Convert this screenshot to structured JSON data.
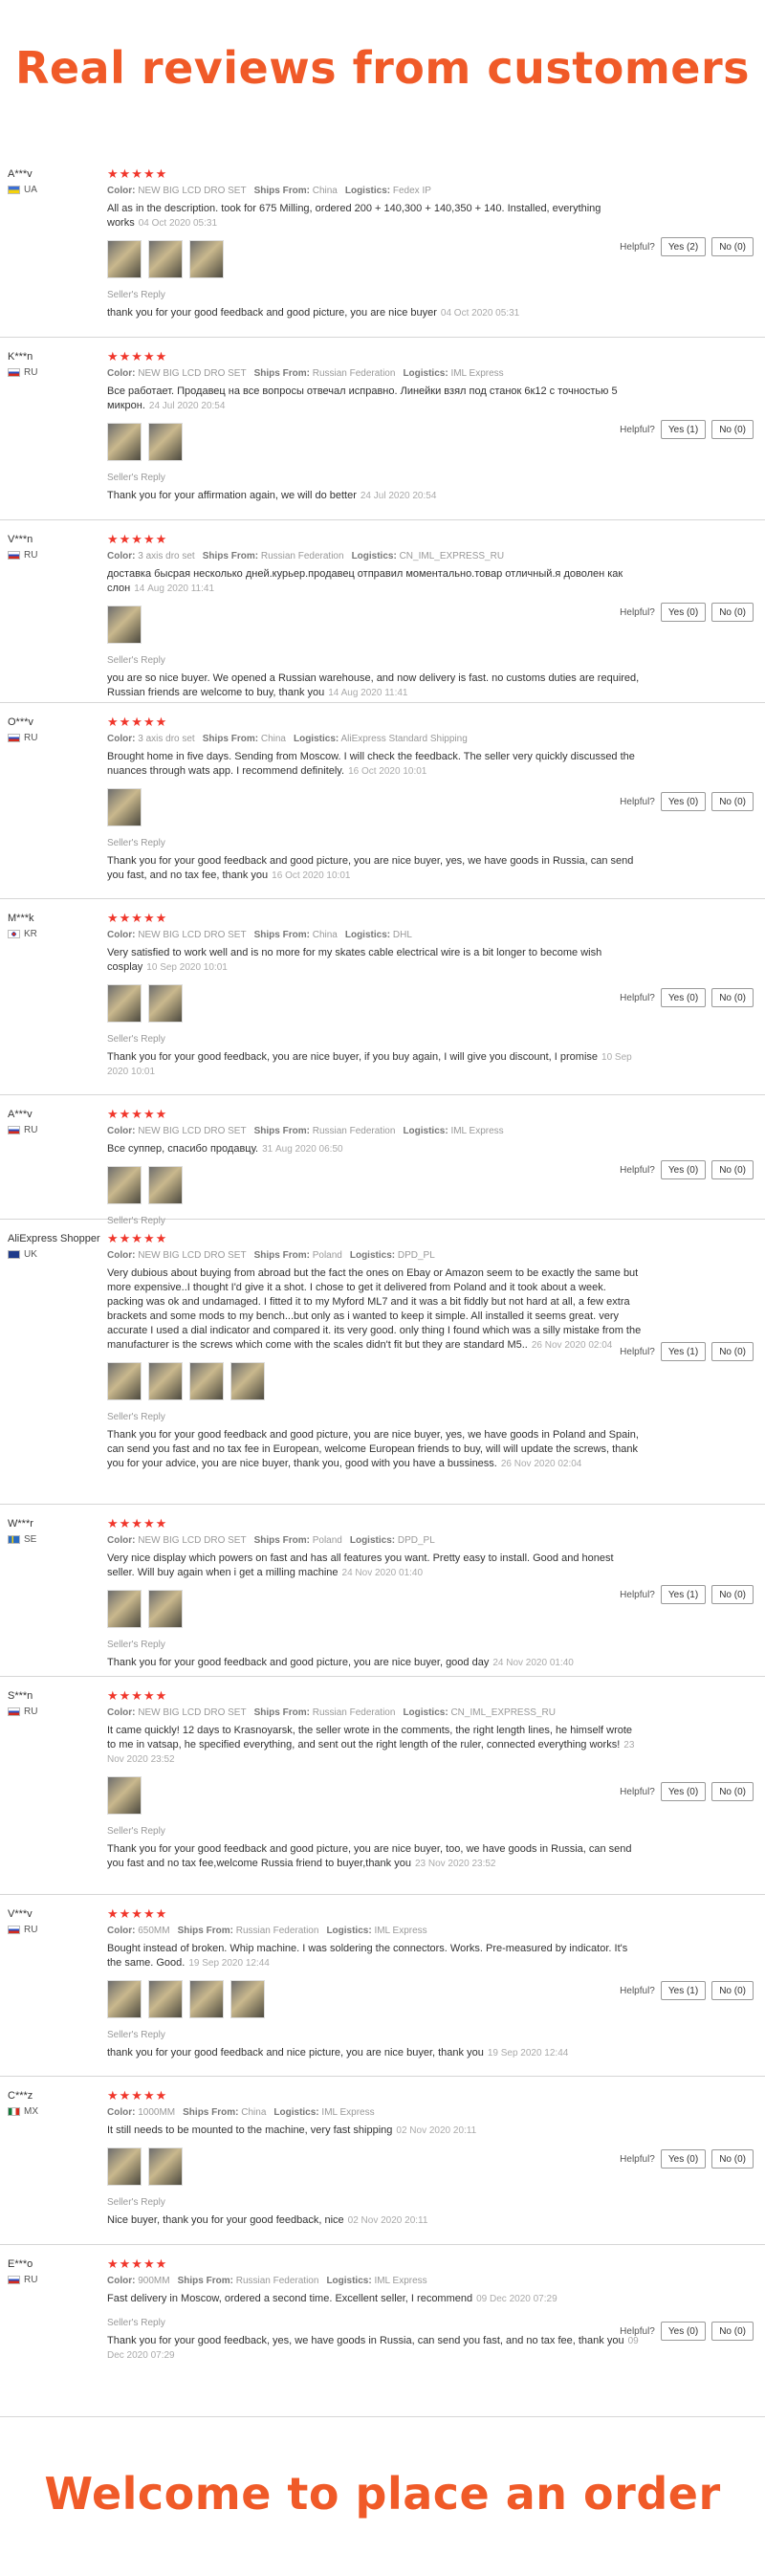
{
  "header": {
    "title": "Real reviews from customers"
  },
  "footer": {
    "title": "Welcome to place an order"
  },
  "labels": {
    "stars": "★★★★★",
    "color": "Color:",
    "ships_from": "Ships From:",
    "logistics": "Logistics:",
    "sellers_reply": "Seller's Reply",
    "helpful": "Helpful?"
  },
  "colors": {
    "accent": "#f05a28",
    "stars": "#f0362b"
  },
  "reviews": [
    {
      "user": "A***v",
      "country": "UA",
      "color": "NEW BIG LCD DRO SET",
      "ships_from": "China",
      "logistics": "Fedex IP",
      "text": "All as in the description. took for 675 Milling, ordered 200 + 140,300 + 140,350 + 140. Installed, everything works",
      "date": "04 Oct 2020 05:31",
      "reply": "thank you for your good feedback and good picture, you are nice buyer",
      "reply_date": "04 Oct 2020 05:31",
      "yes": "Yes (2)",
      "no": "No (0)"
    },
    {
      "user": "K***n",
      "country": "RU",
      "color": "NEW BIG LCD DRO SET",
      "ships_from": "Russian Federation",
      "logistics": "IML Express",
      "text": "Все работает. Продавец на все вопросы отвечал исправно. Линейки взял под станок 6к12 с точностью 5 микрон.",
      "date": "24 Jul 2020 20:54",
      "reply": "Thank you for your affirmation again, we will do better",
      "reply_date": "24 Jul 2020 20:54",
      "yes": "Yes (1)",
      "no": "No (0)"
    },
    {
      "user": "V***n",
      "country": "RU",
      "color": "3 axis dro set",
      "ships_from": "Russian Federation",
      "logistics": "CN_IML_EXPRESS_RU",
      "text": "доставка бысрая несколько дней.курьер.продавец отправил моментально.товар отличный.я доволен как слон",
      "date": "14 Aug 2020 11:41",
      "reply": "you are so nice buyer. We opened a Russian warehouse, and now delivery is fast. no customs duties are required, Russian friends are welcome to buy, thank you",
      "reply_date": "14 Aug 2020 11:41",
      "yes": "Yes (0)",
      "no": "No (0)"
    },
    {
      "user": "O***v",
      "country": "RU",
      "color": "3 axis dro set",
      "ships_from": "China",
      "logistics": "AliExpress Standard Shipping",
      "text": "Brought home in five days. Sending from Moscow. I will check the feedback. The seller very quickly discussed the nuances through wats app. I recommend definitely.",
      "date": "16 Oct 2020 10:01",
      "reply": "Thank you for your good feedback and good picture, you are nice buyer, yes, we have goods in Russia, can send you fast, and no tax fee, thank you",
      "reply_date": "16 Oct 2020 10:01",
      "yes": "Yes (0)",
      "no": "No (0)"
    },
    {
      "user": "M***k",
      "country": "KR",
      "color": "NEW BIG LCD DRO SET",
      "ships_from": "China",
      "logistics": "DHL",
      "text": "Very satisfied to work well and is no more for my skates cable electrical wire is a bit longer to become wish cosplay",
      "date": "10 Sep 2020 10:01",
      "reply": "Thank you for your good feedback, you are nice buyer, if you buy again, I will give you discount, I promise",
      "reply_date": "10 Sep 2020 10:01",
      "yes": "Yes (0)",
      "no": "No (0)"
    },
    {
      "user": "A***v",
      "country": "RU",
      "color": "NEW BIG LCD DRO SET",
      "ships_from": "Russian Federation",
      "logistics": "IML Express",
      "text": "Все суппер, спасибо продавцу.",
      "date": "31 Aug 2020 06:50",
      "reply": "",
      "reply_date": "",
      "yes": "Yes (0)",
      "no": "No (0)"
    },
    {
      "user": "AliExpress Shopper",
      "country": "UK",
      "color": "NEW BIG LCD DRO SET",
      "ships_from": "Poland",
      "logistics": "DPD_PL",
      "text": "Very dubious about buying from abroad but the fact the ones on Ebay or Amazon seem to be exactly the same but more expensive..I thought I'd give it a shot. I chose to get it delivered from Poland and it took about a week. packing was ok and undamaged. I fitted it to my Myford ML7 and it was a bit fiddly but not hard at all, a few extra brackets and some mods to my bench...but only as i wanted to keep it simple. All installed it seems great. very accurate I used a dial indicator and compared it. its very good. only thing I found which was a silly mistake from the manufacturer is the screws which come with the scales didn't fit but they are standard M5..",
      "date": "26 Nov 2020 02:04",
      "reply": "Thank you for your good feedback and good picture, you are nice buyer, yes, we have goods in Poland and Spain, can send you fast and no tax fee in European, welcome European friends to buy, will will update the screws, thank you for your advice, you are nice buyer, thank you, good with you have a bussiness.",
      "reply_date": "26 Nov 2020 02:04",
      "yes": "Yes (1)",
      "no": "No (0)"
    },
    {
      "user": "W***r",
      "country": "SE",
      "color": "NEW BIG LCD DRO SET",
      "ships_from": "Poland",
      "logistics": "DPD_PL",
      "text": "Very nice display which powers on fast and has all features you want. Pretty easy to install. Good and honest seller. Will buy again when i get a milling machine",
      "date": "24 Nov 2020 01:40",
      "reply": "Thank you for your good feedback and good picture, you are nice buyer, good day",
      "reply_date": "24 Nov 2020 01:40",
      "yes": "Yes (1)",
      "no": "No (0)"
    },
    {
      "user": "S***n",
      "country": "RU",
      "color": "NEW BIG LCD DRO SET",
      "ships_from": "Russian Federation",
      "logistics": "CN_IML_EXPRESS_RU",
      "text": "It came quickly! 12 days to Krasnoyarsk, the seller wrote in the comments, the right length lines, he himself wrote to me in vatsap, he specified everything, and sent out the right length of the ruler, connected everything works!",
      "date": "23 Nov 2020 23:52",
      "reply": "Thank you for your good feedback and good picture, you are nice buyer, too, we have goods in Russia, can send you fast and no tax fee,welcome Russia friend to buyer,thank you",
      "reply_date": "23 Nov 2020 23:52",
      "yes": "Yes (0)",
      "no": "No (0)"
    },
    {
      "user": "V***v",
      "country": "RU",
      "color": "650MM",
      "ships_from": "Russian Federation",
      "logistics": "IML Express",
      "text": "Bought instead of broken. Whip machine. I was soldering the connectors. Works. Pre-measured by indicator. It's the same. Good.",
      "date": "19 Sep 2020 12:44",
      "reply": "thank you for your good feedback and nice picture, you are nice buyer, thank you",
      "reply_date": "19 Sep 2020 12:44",
      "yes": "Yes (1)",
      "no": "No (0)"
    },
    {
      "user": "C***z",
      "country": "MX",
      "color": "1000MM",
      "ships_from": "China",
      "logistics": "IML Express",
      "text": "It still needs to be mounted to the machine, very fast shipping",
      "date": "02 Nov 2020 20:11",
      "reply": "Nice buyer, thank you for your good feedback, nice",
      "reply_date": "02 Nov 2020 20:11",
      "yes": "Yes (0)",
      "no": "No (0)"
    },
    {
      "user": "E***o",
      "country": "RU",
      "color": "900MM",
      "ships_from": "Russian Federation",
      "logistics": "IML Express",
      "text": "Fast delivery in Moscow, ordered a second time. Excellent seller, I recommend",
      "date": "09 Dec 2020 07:29",
      "reply": "Thank you for your good feedback, yes, we have goods in Russia, can send you fast, and no tax fee, thank you",
      "reply_date": "09 Dec 2020 07:29",
      "yes": "Yes (0)",
      "no": "No (0)"
    }
  ]
}
